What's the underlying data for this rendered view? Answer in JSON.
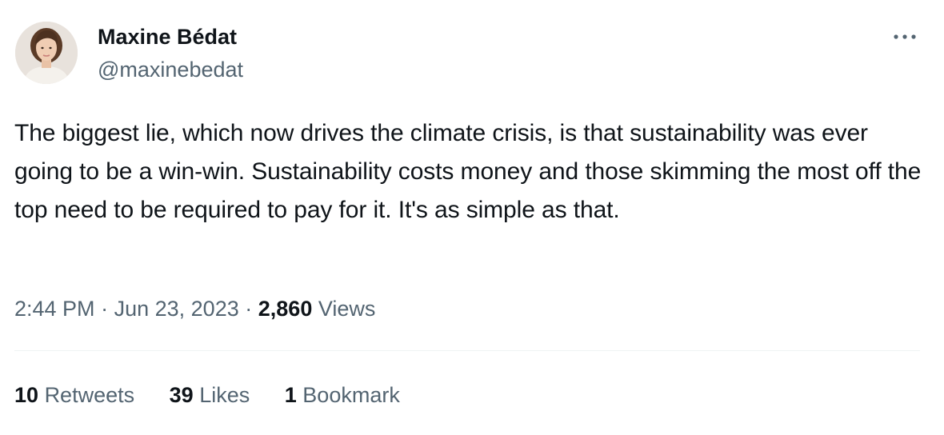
{
  "author": {
    "display_name": "Maxine Bédat",
    "handle": "@maxinebedat"
  },
  "tweet": {
    "text": "The biggest lie, which now drives the climate crisis, is that sustainability was ever going to be a win-win. Sustainability costs money and those skimming the most off the top need to be required to pay for it. It's as simple as that.",
    "time": "2:44 PM",
    "separator": "·",
    "date": "Jun 23, 2023",
    "views_count": "2,860",
    "views_label": "Views"
  },
  "stats": {
    "retweets_count": "10",
    "retweets_label": "Retweets",
    "likes_count": "39",
    "likes_label": "Likes",
    "bookmarks_count": "1",
    "bookmarks_label": "Bookmark"
  },
  "icons": {
    "more": "more-horizontal-icon",
    "avatar": "profile-photo"
  },
  "colors": {
    "primary_text": "#0f1419",
    "secondary_text": "#536471",
    "divider": "#eff3f4",
    "background": "#ffffff"
  }
}
